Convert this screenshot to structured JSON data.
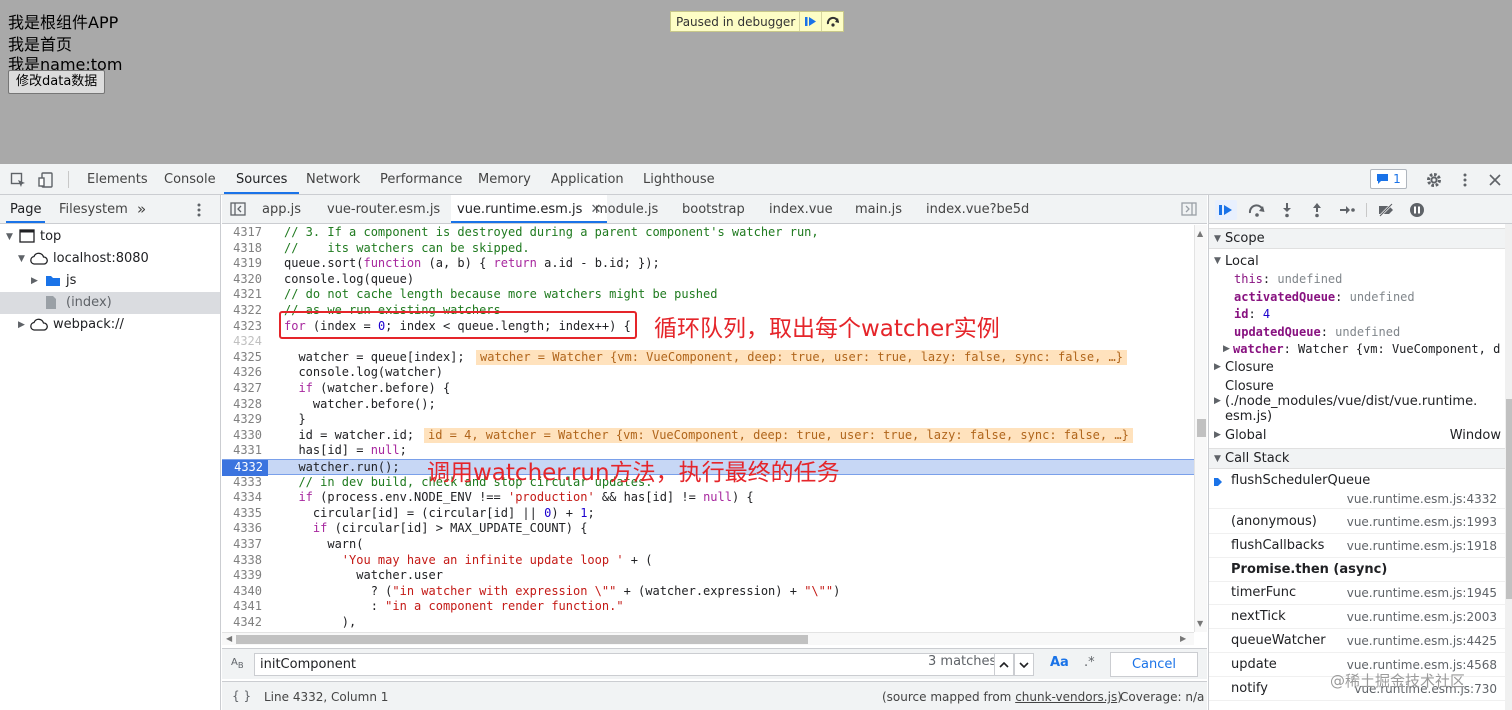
{
  "page": {
    "lines": [
      "我是根组件APP",
      "我是首页",
      "我是name:tom"
    ],
    "button_label": "修改data数据",
    "paused_text": "Paused in debugger"
  },
  "devtools": {
    "tabs": [
      "Elements",
      "Console",
      "Sources",
      "Network",
      "Performance",
      "Memory",
      "Application",
      "Lighthouse"
    ],
    "active_tab": "Sources",
    "message_count": "1"
  },
  "navigator": {
    "tabs": [
      "Page",
      "Filesystem"
    ],
    "more": "»",
    "tree": [
      "top",
      "localhost:8080",
      "js",
      "(index)",
      "webpack://"
    ]
  },
  "editor": {
    "file_tabs": [
      "app.js",
      "vue-router.esm.js",
      "vue.runtime.esm.js",
      "module.js",
      "bootstrap",
      "index.vue",
      "main.js",
      "index.vue?be5d"
    ],
    "active_file": "vue.runtime.esm.js",
    "lines": [
      {
        "n": "4317",
        "html": "<span class=\"cm\">// 3. If a component is destroyed during a parent component's watcher run,</span>"
      },
      {
        "n": "4318",
        "html": "<span class=\"cm\">//    its watchers can be skipped.</span>"
      },
      {
        "n": "4319",
        "html": "queue.sort(<span class=\"kw\">function</span> (a, b) { <span class=\"kw\">return</span> a.id - b.id; });"
      },
      {
        "n": "4320",
        "html": "console.log(queue)"
      },
      {
        "n": "4321",
        "html": "<span class=\"cm\">// do not cache length because more watchers might be pushed</span>"
      },
      {
        "n": "4322",
        "html": "<span class=\"cm\">// as we run existing watchers</span>"
      },
      {
        "n": "4323",
        "html": "<span class=\"kw\">for</span> (index = <span class=\"nm\">0</span>; index &lt; queue.length; index++) {"
      },
      {
        "n": "4324",
        "html": ""
      },
      {
        "n": "4325",
        "html": "  watcher = queue[index];"
      },
      {
        "n": "4326",
        "html": "  console.log(watcher)"
      },
      {
        "n": "4327",
        "html": "  <span class=\"kw\">if</span> (watcher.before) {"
      },
      {
        "n": "4328",
        "html": "    watcher.before();"
      },
      {
        "n": "4329",
        "html": "  }"
      },
      {
        "n": "4330",
        "html": "  id = watcher.id;"
      },
      {
        "n": "4331",
        "html": "  has[id] = <span class=\"kw\">null</span>;"
      },
      {
        "n": "4332",
        "html": "  watcher.run();"
      },
      {
        "n": "4333",
        "html": "  <span class=\"cm\">// in dev build, check and stop circular updates.</span>"
      },
      {
        "n": "4334",
        "html": "  <span class=\"kw\">if</span> (process.env.NODE_ENV !== <span class=\"st\">'production'</span> &amp;&amp; has[id] != <span class=\"kw\">null</span>) {"
      },
      {
        "n": "4335",
        "html": "    circular[id] = (circular[id] || <span class=\"nm\">0</span>) + <span class=\"nm\">1</span>;"
      },
      {
        "n": "4336",
        "html": "    <span class=\"kw\">if</span> (circular[id] &gt; MAX_UPDATE_COUNT) {"
      },
      {
        "n": "4337",
        "html": "      warn("
      },
      {
        "n": "4338",
        "html": "        <span class=\"st\">'You may have an infinite update loop '</span> + ("
      },
      {
        "n": "4339",
        "html": "          watcher.user"
      },
      {
        "n": "4340",
        "html": "            ? (<span class=\"st\">\"in watcher with expression \\\"\"</span> + (watcher.expression) + <span class=\"st\">\"\\\"\"</span>)"
      },
      {
        "n": "4341",
        "html": "            : <span class=\"st\">\"in a component render function.\"</span>"
      },
      {
        "n": "4342",
        "html": "        ),"
      }
    ],
    "exec_line": "4332",
    "inline_values": {
      "4325": "watcher = Watcher {vm: VueComponent, deep: true, user: true, lazy: false, sync: false, …}",
      "4330": "id = 4, watcher = Watcher {vm: VueComponent, deep: true, user: true, lazy: false, sync: false, …}"
    },
    "annotations": {
      "loop": "循环队列，取出每个watcher实例",
      "run": "调用watcher.run方法，执行最终的任务"
    },
    "search_value": "initComponent",
    "search_matches": "3 matches",
    "case_label": "Aa",
    "regex_label": ".*",
    "cancel_label": "Cancel",
    "status_position": "Line 4332, Column 1",
    "source_mapped_prefix": "(source mapped from ",
    "source_mapped_file": "chunk-vendors.js",
    "source_mapped_suffix": ")",
    "coverage": "Coverage: n/a"
  },
  "debugger": {
    "scope_title": "Scope",
    "local_title": "Local",
    "local_vars": [
      {
        "name": "this",
        "value": "undefined",
        "bold": false
      },
      {
        "name": "activatedQueue",
        "value": "undefined",
        "bold": true
      },
      {
        "name": "id",
        "value": "4",
        "bold": true
      },
      {
        "name": "updatedQueue",
        "value": "undefined",
        "bold": true
      }
    ],
    "watcher_name": "watcher",
    "watcher_value": "Watcher {vm: VueComponent, d",
    "closure_1": "Closure",
    "closure_2_title": "Closure",
    "closure_2_path": "(./node_modules/vue/dist/vue.runtime.",
    "closure_2_path2": "esm.js)",
    "global_title": "Global",
    "global_value": "Window",
    "callstack_title": "Call Stack",
    "callstack": [
      {
        "fn": "flushSchedulerQueue",
        "loc": "vue.runtime.esm.js:4332"
      },
      {
        "fn": "(anonymous)",
        "loc": "vue.runtime.esm.js:1993"
      },
      {
        "fn": "flushCallbacks",
        "loc": "vue.runtime.esm.js:1918"
      },
      {
        "fn": "Promise.then (async)",
        "loc": ""
      },
      {
        "fn": "timerFunc",
        "loc": "vue.runtime.esm.js:1945"
      },
      {
        "fn": "nextTick",
        "loc": "vue.runtime.esm.js:2003"
      },
      {
        "fn": "queueWatcher",
        "loc": "vue.runtime.esm.js:4425"
      },
      {
        "fn": "update",
        "loc": "vue.runtime.esm.js:4568"
      },
      {
        "fn": "notify",
        "loc": "vue.runtime.esm.js:730"
      }
    ]
  },
  "watermark": "@稀土掘金技术社区",
  "colors": {
    "accent": "#1a73e8",
    "annotation": "#e5252a",
    "exec_line_bg": "#c7d7f5"
  }
}
